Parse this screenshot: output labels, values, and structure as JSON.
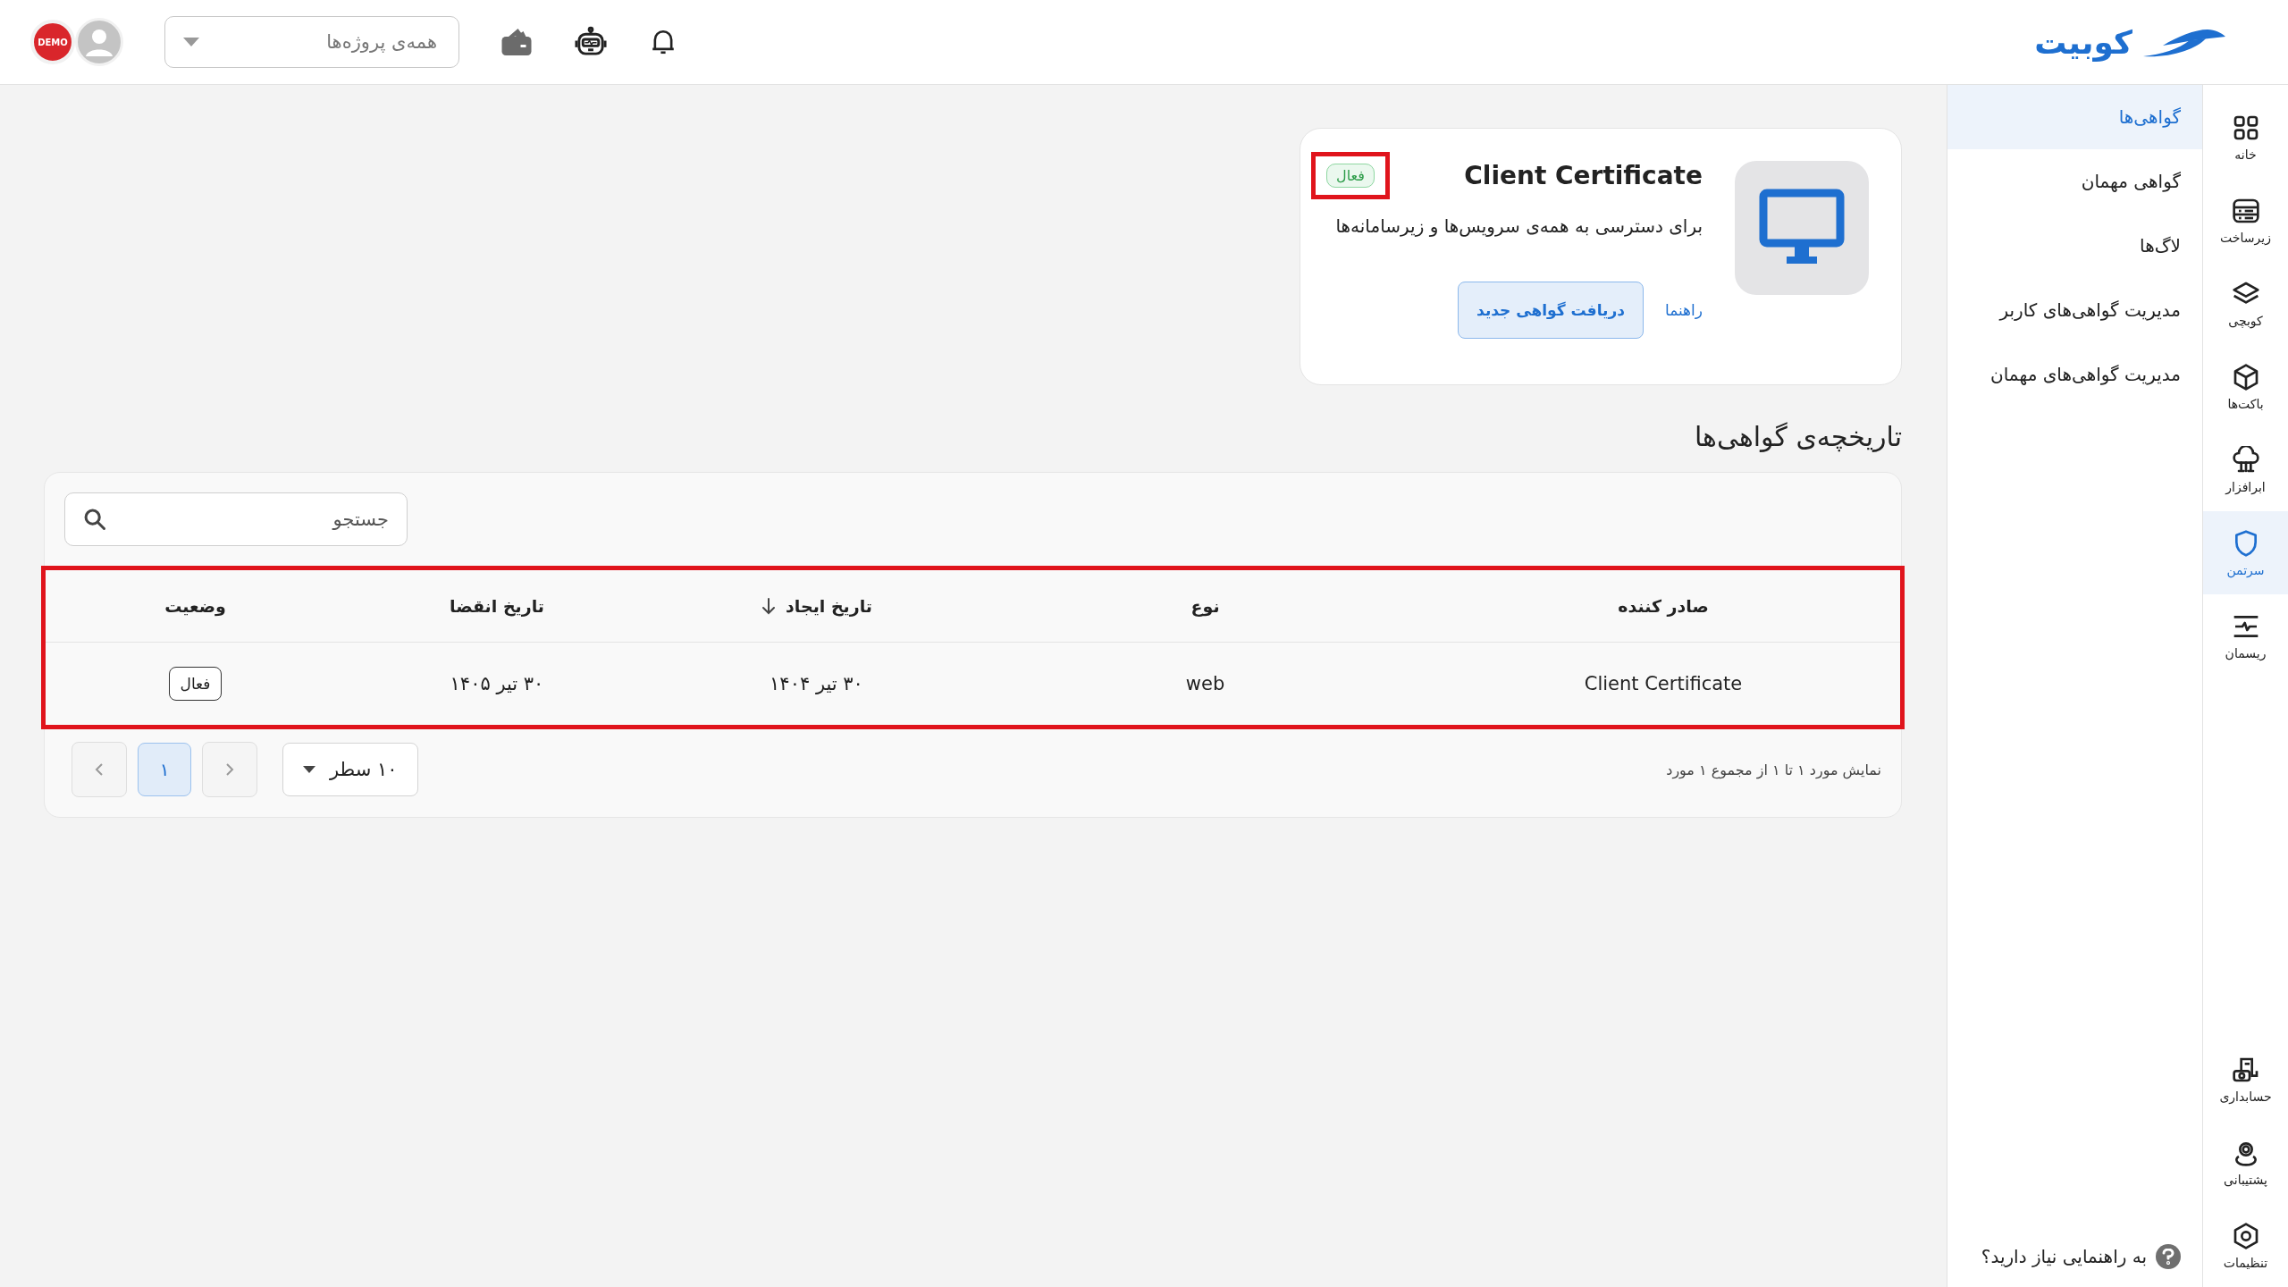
{
  "header": {
    "logo_text": "کوبیت",
    "project_select": {
      "placeholder": "همه‌ی پروژه‌ها"
    },
    "demo_stamp": "DEMO"
  },
  "nav_rail": {
    "items": [
      {
        "label": "خانه",
        "kind": "grid",
        "selected": false
      },
      {
        "label": "زیرساخت",
        "kind": "server",
        "selected": false
      },
      {
        "label": "کوبچی",
        "kind": "layers",
        "selected": false
      },
      {
        "label": "باکت‌ها",
        "kind": "box",
        "selected": false
      },
      {
        "label": "ابرافزار",
        "kind": "cloud",
        "selected": false
      },
      {
        "label": "سرتمن",
        "kind": "shield",
        "selected": true
      },
      {
        "label": "ریسمان",
        "kind": "pulse",
        "selected": false
      }
    ],
    "bottom_items": [
      {
        "label": "حسابداری",
        "kind": "accounting",
        "selected": false
      },
      {
        "label": "پشتیبانی",
        "kind": "support",
        "selected": false
      },
      {
        "label": "تنظیمات",
        "kind": "settings",
        "selected": false
      }
    ]
  },
  "submenu": {
    "items": [
      {
        "label": "گواهی‌ها",
        "selected": true
      },
      {
        "label": "گواهی مهمان",
        "selected": false
      },
      {
        "label": "لاگ‌ها",
        "selected": false
      },
      {
        "label": "مدیریت گواهی‌های کاربر",
        "selected": false
      },
      {
        "label": "مدیریت گواهی‌های مهمان",
        "selected": false
      }
    ],
    "help": "به راهنمایی نیاز دارید؟"
  },
  "certificate_card": {
    "title": "Client Certificate",
    "status": {
      "label": "فعال",
      "highlighted": true
    },
    "description": "برای دسترسی به همه‌ی سرویس‌ها و زیرسامانه‌ها",
    "primary_button": "دریافت گواهی جدید",
    "link": "راهنما"
  },
  "history": {
    "title": "تاریخچه‌ی گواهی‌ها",
    "search": {
      "placeholder": "جستجو"
    },
    "table_highlighted": true,
    "columns": [
      {
        "label": "صادر کننده",
        "sorted": false
      },
      {
        "label": "نوع",
        "sorted": false
      },
      {
        "label": "تاریخ ایجاد",
        "sorted": true
      },
      {
        "label": "تاریخ انقضا",
        "sorted": false
      },
      {
        "label": "وضعیت",
        "sorted": false
      }
    ],
    "rows": [
      {
        "cells": [
          "Client Certificate",
          "web",
          "۳۰ تیر ۱۴۰۴",
          "۳۰ تیر ۱۴۰۵"
        ],
        "status": "فعال"
      }
    ],
    "summary": "نمایش مورد ۱ تا ۱ از مجموع ۱ مورد",
    "page_size": "۱۰ سطر",
    "pages": [
      {
        "label": "۱",
        "selected": true
      }
    ]
  }
}
